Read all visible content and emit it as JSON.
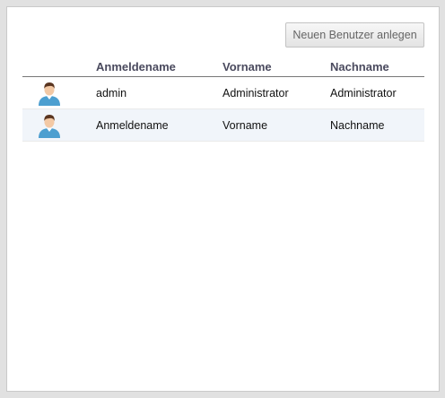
{
  "toolbar": {
    "new_user_label": "Neuen Benutzer anlegen"
  },
  "table": {
    "columns": [
      "Anmeldename",
      "Vorname",
      "Nachname"
    ],
    "rows": [
      {
        "avatar_icon": "user-avatar-icon",
        "login": "admin",
        "firstname": "Administrator",
        "lastname": "Administrator"
      },
      {
        "avatar_icon": "user-avatar-icon",
        "login": "Anmeldename",
        "firstname": "Vorname",
        "lastname": "Nachname"
      }
    ]
  },
  "colors": {
    "header_text": "#4a4a5e",
    "alt_row_bg": "#f1f5fa",
    "avatar_shirt": "#4d9fd0",
    "avatar_hair": "#5a3520"
  }
}
